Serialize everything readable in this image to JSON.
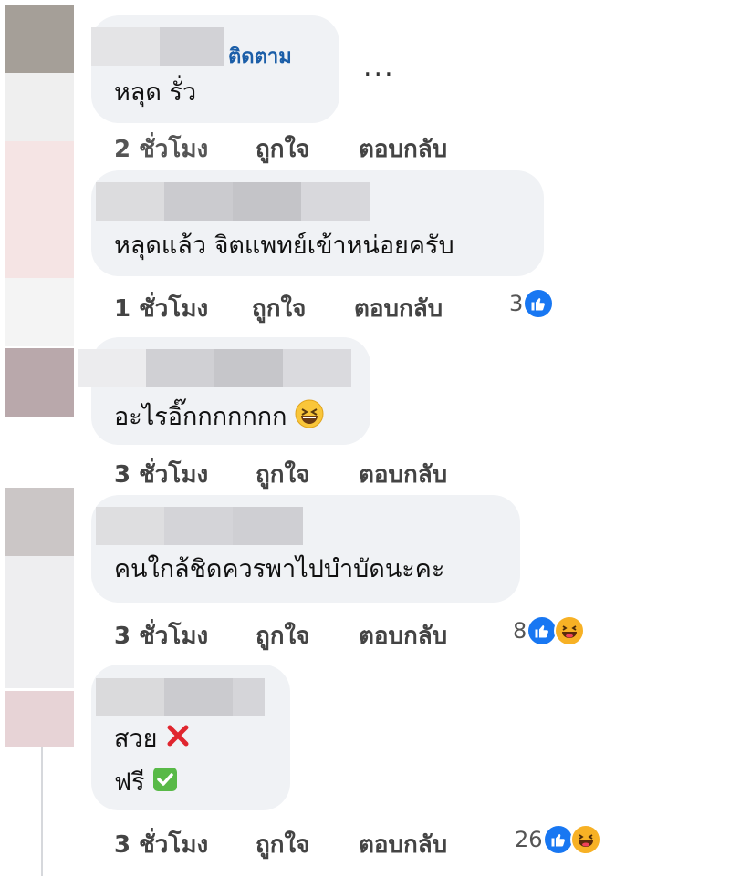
{
  "comments": [
    {
      "follow_label": "ติดตาม",
      "text": "หลุด รั่ว",
      "time": "2 ชั่วโมง",
      "like_label": "ถูกใจ",
      "reply_label": "ตอบกลับ",
      "more_label": "..."
    },
    {
      "text": "หลุดแล้ว จิตแพทย์เข้าหน่อยครับ",
      "time": "1 ชั่วโมง",
      "like_label": "ถูกใจ",
      "reply_label": "ตอบกลับ",
      "reaction_count": "3"
    },
    {
      "text": "อะไรอิ๊กกกกกกก",
      "time": "3 ชั่วโมง",
      "like_label": "ถูกใจ",
      "reply_label": "ตอบกลับ"
    },
    {
      "text": "คนใกล้ชิดควรพาไปบำบัดนะคะ",
      "time": "3 ชั่วโมง",
      "like_label": "ถูกใจ",
      "reply_label": "ตอบกลับ",
      "reaction_count": "8"
    },
    {
      "text_line1": "สวย",
      "text_line2": "ฟรี",
      "time": "3 ชั่วโมง",
      "like_label": "ถูกใจ",
      "reply_label": "ตอบกลับ",
      "reaction_count": "26"
    }
  ],
  "icons": {
    "like": "like-reaction-icon",
    "haha": "haha-reaction-icon",
    "laugh_emoji": "grinning-squinting-emoji",
    "cross": "cross-mark-emoji",
    "check": "check-mark-emoji"
  },
  "colors": {
    "bubble": "#f0f2f5",
    "follow_link": "#1b5ea8",
    "like_blue": "#1877f2",
    "haha_yellow": "#f7b125"
  }
}
